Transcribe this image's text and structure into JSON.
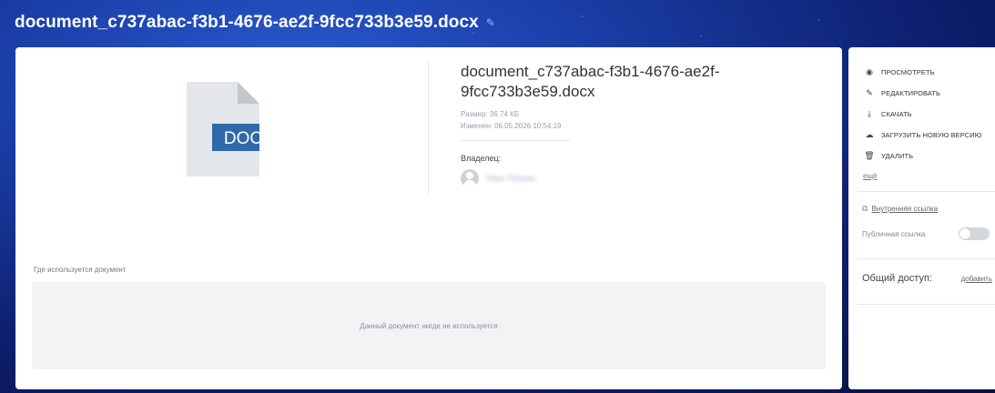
{
  "header": {
    "title": "document_c737abac-f3b1-4676-ae2f-9fcc733b3e59.docx",
    "edit_icon": "pencil-icon"
  },
  "preview": {
    "badge": "DOC",
    "badge_color": "#2f6aa8",
    "icon": "file-doc-icon"
  },
  "info": {
    "name": "document_c737abac-f3b1-4676-ae2f-9fcc733b3e59.docx",
    "size": "Размер: 36.74 КБ",
    "modified": "Изменен: 06.05.2026 10:54:19",
    "owner_label": "Владелец:",
    "owner_name": "Иван Петров"
  },
  "usage": {
    "label": "Где используется документ",
    "empty_text": "Данный документ нигде не используется"
  },
  "actions": [
    {
      "icon": "eye-icon",
      "label": "ПРОСМОТРЕТЬ"
    },
    {
      "icon": "pencil-icon",
      "label": "РЕДАКТИРОВАТЬ"
    },
    {
      "icon": "download-icon",
      "label": "СКАЧАТЬ"
    },
    {
      "icon": "cloud-upload-icon",
      "label": "ЗАГРУЗИТЬ НОВУЮ ВЕРСИЮ"
    },
    {
      "icon": "trash-icon",
      "label": "УДАЛИТЬ"
    }
  ],
  "more_label": "ещё",
  "links": {
    "internal_label": "Внутренняя ссылка",
    "public_label": "Публичная ссылка",
    "public_enabled": false
  },
  "sharing": {
    "label": "Общий доступ:",
    "add_label": "добавить"
  }
}
